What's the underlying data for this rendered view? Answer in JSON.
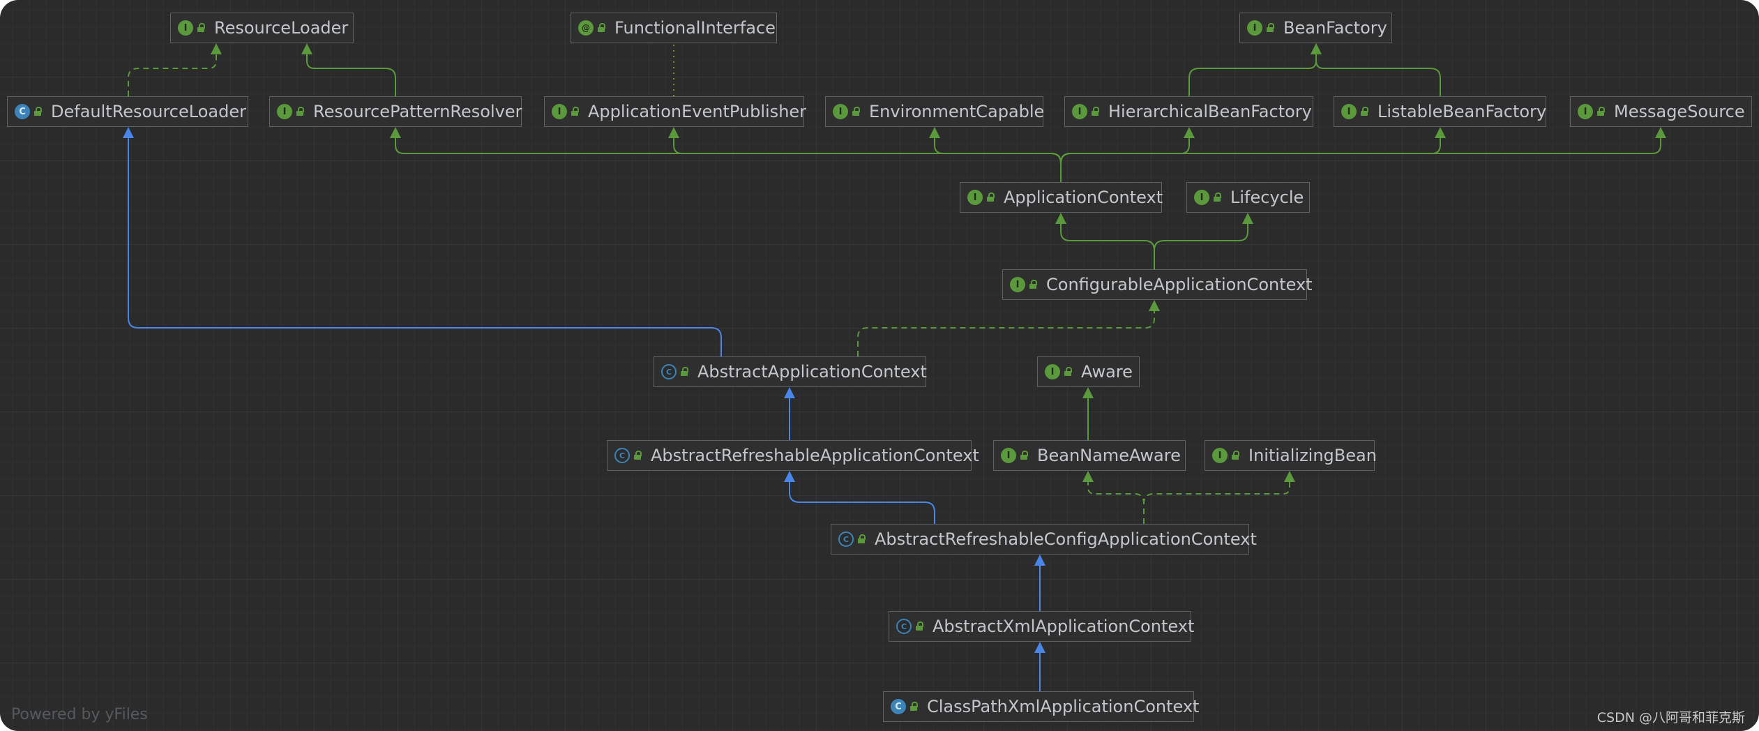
{
  "diagram": {
    "nodes": [
      {
        "id": "resourceloader",
        "label": "ResourceLoader",
        "kind": "interface"
      },
      {
        "id": "functionalinterface",
        "label": "FunctionalInterface",
        "kind": "annotation"
      },
      {
        "id": "beanfactory",
        "label": "BeanFactory",
        "kind": "interface"
      },
      {
        "id": "defaultresourceloader",
        "label": "DefaultResourceLoader",
        "kind": "class"
      },
      {
        "id": "resourcepatternresolver",
        "label": "ResourcePatternResolver",
        "kind": "interface"
      },
      {
        "id": "applicationeventpublisher",
        "label": "ApplicationEventPublisher",
        "kind": "interface"
      },
      {
        "id": "environmentcapable",
        "label": "EnvironmentCapable",
        "kind": "interface"
      },
      {
        "id": "hierarchicalbeanfactory",
        "label": "HierarchicalBeanFactory",
        "kind": "interface"
      },
      {
        "id": "listablebeanfactory",
        "label": "ListableBeanFactory",
        "kind": "interface"
      },
      {
        "id": "messagesource",
        "label": "MessageSource",
        "kind": "interface"
      },
      {
        "id": "applicationcontext",
        "label": "ApplicationContext",
        "kind": "interface"
      },
      {
        "id": "lifecycle",
        "label": "Lifecycle",
        "kind": "interface"
      },
      {
        "id": "configurableapplicationcontext",
        "label": "ConfigurableApplicationContext",
        "kind": "interface"
      },
      {
        "id": "abstractapplicationcontext",
        "label": "AbstractApplicationContext",
        "kind": "abstract"
      },
      {
        "id": "aware",
        "label": "Aware",
        "kind": "interface"
      },
      {
        "id": "abstractrefreshableapplicationcontext",
        "label": "AbstractRefreshableApplicationContext",
        "kind": "abstract"
      },
      {
        "id": "beannameaware",
        "label": "BeanNameAware",
        "kind": "interface"
      },
      {
        "id": "initializingbean",
        "label": "InitializingBean",
        "kind": "interface"
      },
      {
        "id": "abstractrefreshableconfigapplicationcontext",
        "label": "AbstractRefreshableConfigApplicationContext",
        "kind": "abstract"
      },
      {
        "id": "abstractxmlapplicationcontext",
        "label": "AbstractXmlApplicationContext",
        "kind": "abstract"
      },
      {
        "id": "classpathxmlapplicationcontext",
        "label": "ClassPathXmlApplicationContext",
        "kind": "class"
      }
    ],
    "edges": [
      {
        "from": "defaultresourceloader",
        "to": "resourceloader",
        "type": "implements"
      },
      {
        "from": "resourcepatternresolver",
        "to": "resourceloader",
        "type": "extends-interface"
      },
      {
        "from": "applicationeventpublisher",
        "to": "functionalinterface",
        "type": "annotated"
      },
      {
        "from": "hierarchicalbeanfactory",
        "to": "beanfactory",
        "type": "extends-interface"
      },
      {
        "from": "listablebeanfactory",
        "to": "beanfactory",
        "type": "extends-interface"
      },
      {
        "from": "applicationcontext",
        "to": "resourcepatternresolver",
        "type": "extends-interface"
      },
      {
        "from": "applicationcontext",
        "to": "applicationeventpublisher",
        "type": "extends-interface"
      },
      {
        "from": "applicationcontext",
        "to": "environmentcapable",
        "type": "extends-interface"
      },
      {
        "from": "applicationcontext",
        "to": "hierarchicalbeanfactory",
        "type": "extends-interface"
      },
      {
        "from": "applicationcontext",
        "to": "listablebeanfactory",
        "type": "extends-interface"
      },
      {
        "from": "applicationcontext",
        "to": "messagesource",
        "type": "extends-interface"
      },
      {
        "from": "configurableapplicationcontext",
        "to": "applicationcontext",
        "type": "extends-interface"
      },
      {
        "from": "configurableapplicationcontext",
        "to": "lifecycle",
        "type": "extends-interface"
      },
      {
        "from": "abstractapplicationcontext",
        "to": "defaultresourceloader",
        "type": "extends-class"
      },
      {
        "from": "abstractapplicationcontext",
        "to": "configurableapplicationcontext",
        "type": "implements"
      },
      {
        "from": "beannameaware",
        "to": "aware",
        "type": "extends-interface"
      },
      {
        "from": "abstractrefreshableapplicationcontext",
        "to": "abstractapplicationcontext",
        "type": "extends-class"
      },
      {
        "from": "abstractrefreshableconfigapplicationcontext",
        "to": "abstractrefreshableapplicationcontext",
        "type": "extends-class"
      },
      {
        "from": "abstractrefreshableconfigapplicationcontext",
        "to": "beannameaware",
        "type": "implements"
      },
      {
        "from": "abstractrefreshableconfigapplicationcontext",
        "to": "initializingbean",
        "type": "implements"
      },
      {
        "from": "abstractxmlapplicationcontext",
        "to": "abstractrefreshableconfigapplicationcontext",
        "type": "extends-class"
      },
      {
        "from": "classpathxmlapplicationcontext",
        "to": "abstractxmlapplicationcontext",
        "type": "extends-class"
      }
    ],
    "kind_glyphs": {
      "interface": "I",
      "class": "C",
      "abstract": "C",
      "annotation": "@"
    },
    "colors": {
      "background": "#2b2b2b",
      "node_fill": "#2f2f2f",
      "node_border": "#5e6165",
      "label": "#c3c7cc",
      "interface_green": "#5b9a3c",
      "extends_blue": "#4a86e8",
      "class_blue": "#3c83b8"
    }
  },
  "footer": {
    "powered_by": "Powered by yFiles",
    "watermark": "CSDN @八阿哥和菲克斯"
  }
}
